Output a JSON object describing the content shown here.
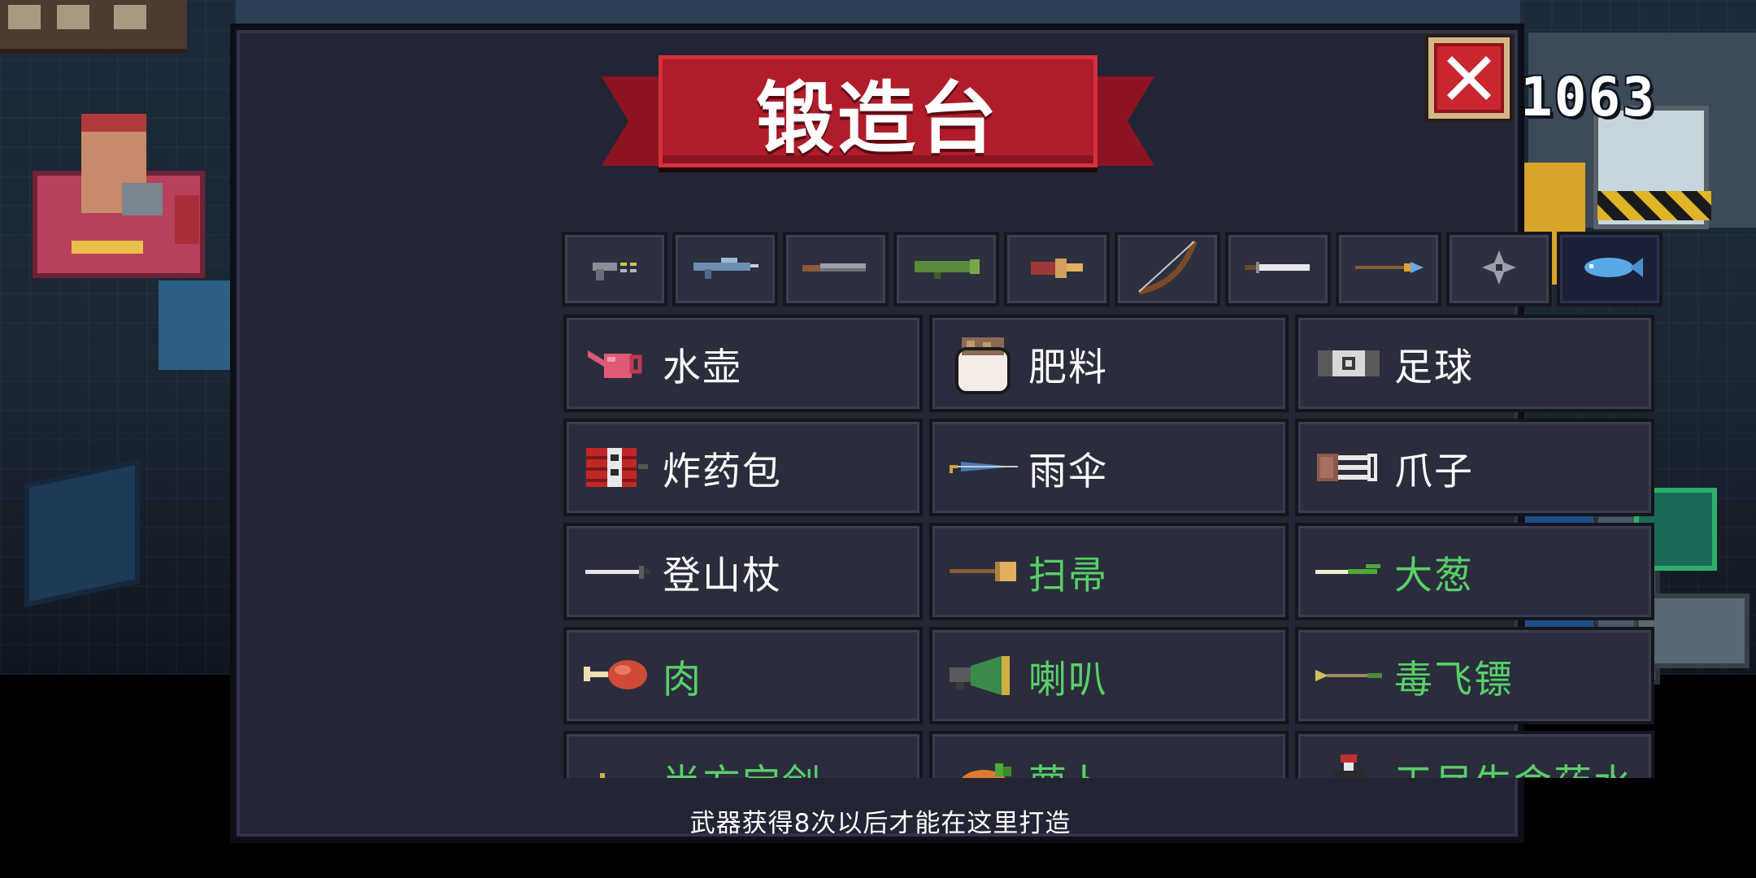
{
  "hud": {
    "score": "1063"
  },
  "modal": {
    "title": "锻造台",
    "close_icon": "close-icon",
    "hint": "武器获得8次以后才能在这里打造",
    "tabs": [
      {
        "icon": "pistol-icon",
        "active": false
      },
      {
        "icon": "rifle-icon",
        "active": false
      },
      {
        "icon": "shotgun-icon",
        "active": false
      },
      {
        "icon": "launcher-icon",
        "active": false
      },
      {
        "icon": "flamethrower-icon",
        "active": false
      },
      {
        "icon": "bow-icon",
        "active": false
      },
      {
        "icon": "sword-icon",
        "active": false
      },
      {
        "icon": "spear-icon",
        "active": false
      },
      {
        "icon": "shuriken-icon",
        "active": false
      },
      {
        "icon": "fish-icon",
        "active": true
      }
    ],
    "items": [
      {
        "name": "水壶",
        "icon": "watering-can-icon",
        "unlocked": false
      },
      {
        "name": "肥料",
        "icon": "fertilizer-bag-icon",
        "unlocked": false
      },
      {
        "name": "足球",
        "icon": "soccer-ball-icon",
        "unlocked": false
      },
      {
        "name": "炸药包",
        "icon": "dynamite-pack-icon",
        "unlocked": false
      },
      {
        "name": "雨伞",
        "icon": "umbrella-icon",
        "unlocked": false
      },
      {
        "name": "爪子",
        "icon": "claw-icon",
        "unlocked": false
      },
      {
        "name": "登山杖",
        "icon": "trekking-pole-icon",
        "unlocked": false
      },
      {
        "name": "扫帚",
        "icon": "broom-icon",
        "unlocked": true
      },
      {
        "name": "大葱",
        "icon": "scallion-icon",
        "unlocked": true
      },
      {
        "name": "肉",
        "icon": "meat-icon",
        "unlocked": true
      },
      {
        "name": "喇叭",
        "icon": "horn-icon",
        "unlocked": true
      },
      {
        "name": "毒飞镖",
        "icon": "poison-dart-icon",
        "unlocked": true
      },
      {
        "name": "尚方宝剑",
        "icon": "imperial-sword-icon",
        "unlocked": true
      },
      {
        "name": "萝卜",
        "icon": "radish-icon",
        "unlocked": true
      },
      {
        "name": "天尽生命药水",
        "icon": "potion-icon",
        "unlocked": true
      }
    ]
  },
  "colors": {
    "panel": "#232535",
    "cell": "#2b2d3c",
    "locked_text": "#ffffff",
    "unlocked_text": "#58d068",
    "banner": "#b01c2a",
    "close": "#c92630"
  }
}
